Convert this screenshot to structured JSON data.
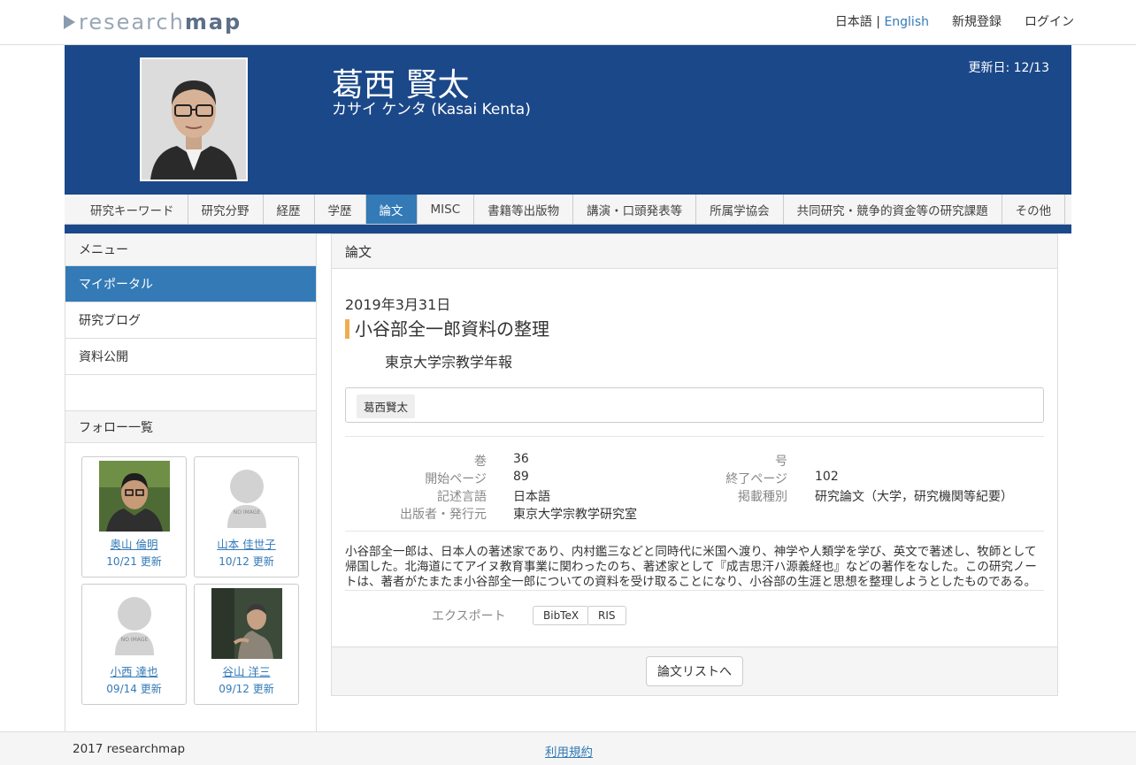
{
  "brand": {
    "logo_light": "research",
    "logo_dark": "map"
  },
  "topnav": {
    "lang_ja": "日本語",
    "lang_sep": "|",
    "lang_en": "English",
    "register": "新規登録",
    "login": "ログイン"
  },
  "profile": {
    "name": "葛西 賢太",
    "kana": "カサイ ケンタ  (Kasai Kenta)",
    "updated": "更新日: 12/13"
  },
  "tabs": [
    "研究キーワード",
    "研究分野",
    "経歴",
    "学歴",
    "論文",
    "MISC",
    "書籍等出版物",
    "講演・口頭発表等",
    "所属学協会",
    "共同研究・競争的資金等の研究課題",
    "その他"
  ],
  "active_tab": "論文",
  "sidebar": {
    "menu_heading": "メニュー",
    "items": [
      "マイポータル",
      "研究ブログ",
      "資料公開"
    ],
    "follow_heading": "フォロー一覧",
    "follows": [
      {
        "name": "奥山 倫明",
        "updated": "10/21 更新"
      },
      {
        "name": "山本 佳世子",
        "updated": "10/12 更新"
      },
      {
        "name": "小西 達也",
        "updated": "09/14 更新"
      },
      {
        "name": "谷山 洋三",
        "updated": "09/12 更新"
      }
    ],
    "no_image_text": "NO IMAGE"
  },
  "paper": {
    "section_heading": "論文",
    "date": "2019年3月31日",
    "title": "小谷部全一郎資料の整理",
    "journal": "東京大学宗教学年報",
    "author": "葛西賢太",
    "meta": {
      "volume_label": "巻",
      "volume": "36",
      "issue_label": "号",
      "issue": "",
      "start_page_label": "開始ページ",
      "start_page": "89",
      "end_page_label": "終了ページ",
      "end_page": "102",
      "language_label": "記述言語",
      "language": "日本語",
      "type_label": "掲載種別",
      "type": "研究論文（大学，研究機関等紀要）",
      "publisher_label": "出版者・発行元",
      "publisher": "東京大学宗教学研究室"
    },
    "abstract": "小谷部全一郎は、日本人の著述家であり、内村鑑三などと同時代に米国へ渡り、神学や人類学を学び、英文で著述し、牧師として帰国した。北海道にてアイヌ教育事業に関わったのち、著述家として『成吉思汗ハ源義経也』などの著作をなした。この研究ノートは、著者がたまたま小谷部全一郎についての資料を受け取ることになり、小谷部の生涯と思想を整理しようとしたものである。",
    "export_label": "エクスポート",
    "export_bibtex": "BibTeX",
    "export_ris": "RIS",
    "list_button": "論文リストへ"
  },
  "footer": {
    "copyright": "2017 researchmap",
    "terms": "利用規約"
  }
}
